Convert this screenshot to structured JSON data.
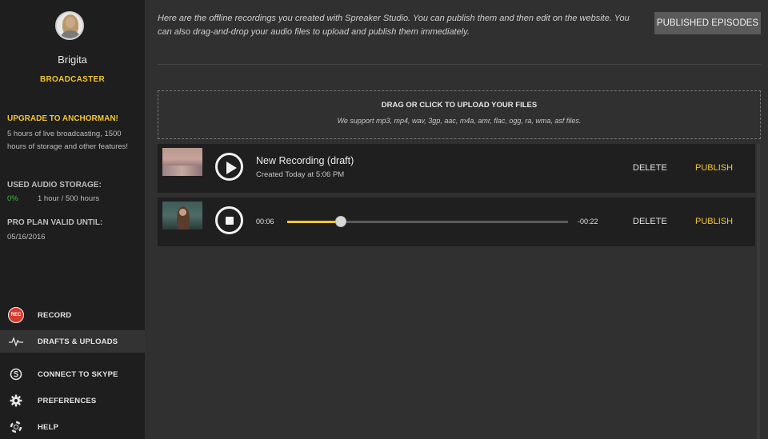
{
  "user": {
    "name": "Brigita",
    "role": "BROADCASTER"
  },
  "plan": {
    "upgrade_title": "UPGRADE TO ANCHORMAN!",
    "upgrade_text": "5 hours of live broadcasting, 1500 hours of storage and other features!",
    "storage_label": "USED AUDIO STORAGE:",
    "storage_percent": "0%",
    "storage_hours": "1 hour / 500 hours",
    "valid_label": "PRO PLAN VALID UNTIL:",
    "valid_date": "05/16/2016"
  },
  "nav": {
    "record_badge": "REC",
    "record": "RECORD",
    "drafts": "DRAFTS & UPLOADS",
    "skype": "CONNECT TO SKYPE",
    "preferences": "PREFERENCES",
    "help": "HELP"
  },
  "main": {
    "intro": "Here are the offline recordings you created with Spreaker Studio. You can publish them and then edit on the website. You can also drag-and-drop your audio files to upload and publish them immediately.",
    "published_button": "PUBLISHED EPISODES",
    "dropzone_title": "DRAG OR CLICK TO UPLOAD YOUR FILES",
    "dropzone_sub": "We support mp3, mp4, wav, 3gp, aac, m4a, amr, flac, ogg, ra, wma, asf files."
  },
  "recordings": [
    {
      "title": "New Recording (draft)",
      "created": "Created Today at 5:06 PM",
      "delete": "DELETE",
      "publish": "PUBLISH"
    },
    {
      "current_time": "00:06",
      "remaining_time": "-00:22",
      "progress": 0.19,
      "delete": "DELETE",
      "publish": "PUBLISH"
    }
  ],
  "colors": {
    "accent": "#f2c631",
    "storage_green": "#3fbf3f",
    "record_red": "#d63a2f"
  },
  "icons": {
    "record": "rec-badge-icon",
    "drafts": "waveform-icon",
    "skype": "skype-icon",
    "preferences": "gear-icon",
    "help": "lifebuoy-icon"
  }
}
